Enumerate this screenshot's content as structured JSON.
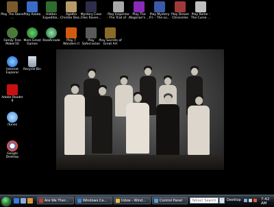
{
  "desktop": {
    "icons": [
      {
        "label": "Play The Stone ...",
        "color": "#7a5a2c"
      },
      {
        "label": "Play Azada",
        "color": "#3a6bc8"
      },
      {
        "label": "Hidden Expeditio...",
        "color": "#2f6d2f"
      },
      {
        "label": "Agatha Christie Dea...",
        "color": "#b79a6a"
      },
      {
        "label": "Mystery Case Files Raven...",
        "color": "#2d2d4a"
      },
      {
        "label": "Play Inspector - The Trail of ...",
        "color": "#a8a8a8"
      },
      {
        "label": "Play The Magician's ...",
        "color": "#8a2ab8"
      },
      {
        "label": "Play Mystery P.I. - The Lo...",
        "color": "#3a5aa8"
      },
      {
        "label": "Play Dream Chronicles",
        "color": "#a03a3a"
      },
      {
        "label": "Play Rome - The Curse ...",
        "color": "#c0c0c0"
      },
      {
        "label": "Family Tree Maker16",
        "color": "#4a7a3a"
      },
      {
        "label": "More Great Games",
        "color": "#2a8a3a"
      },
      {
        "label": "RealArcade",
        "color": "#3a9a5a"
      },
      {
        "label": "Play 7 Wonders II",
        "color": "#d05a10"
      },
      {
        "label": "Play Safecracker",
        "color": "#5a5a5a"
      },
      {
        "label": "Play Secrets of Great Art",
        "color": "#8a6a2a"
      },
      {
        "label": "Internet Explorer",
        "color": "#2a7ad8"
      },
      {
        "label": "Recycle Bin",
        "color": "#9aa8b8"
      },
      {
        "label": "Adobe Reader 8",
        "color": "#c81010"
      },
      {
        "label": "iTunes",
        "color": "#5aa0e8"
      },
      {
        "label": "Google Desktop",
        "color": "#3a7ae8"
      }
    ]
  },
  "taskbar": {
    "buttons": [
      {
        "label": "Are We Ther...",
        "color": "#c0402a"
      },
      {
        "label": "Windows Ca...",
        "color": "#3a88d8"
      },
      {
        "label": "Inbox - Wind...",
        "color": "#e8c03a"
      },
      {
        "label": "Control Panel",
        "color": "#5aa0d0"
      }
    ],
    "search_placeholder": "Yahoo! Search",
    "desktop_label": "Desktop",
    "clock": "7:42 AM"
  }
}
